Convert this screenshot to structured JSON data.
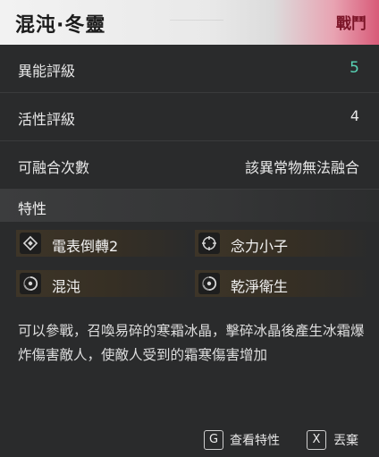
{
  "header": {
    "title": "混沌·冬靈",
    "tag": "戰鬥"
  },
  "stats": [
    {
      "label": "異能評級",
      "value": "5"
    },
    {
      "label": "活性評級",
      "value": "4"
    },
    {
      "label": "可融合次數",
      "value": "該異常物無法融合"
    }
  ],
  "traits_section": {
    "title": "特性",
    "items": [
      {
        "label": "電表倒轉2",
        "icon": "diamond-icon"
      },
      {
        "label": "念力小子",
        "icon": "crosshair-icon"
      },
      {
        "label": "混沌",
        "icon": "swirl-icon"
      },
      {
        "label": "乾淨衛生",
        "icon": "swirl-icon"
      }
    ]
  },
  "description": "可以參戰，召喚易碎的寒霜冰晶，擊碎冰晶後產生冰霜爆炸傷害敵人，使敵人受到的霜寒傷害增加",
  "footer": {
    "view_key": "G",
    "view_label": "查看特性",
    "drop_key": "X",
    "drop_label": "丟棄"
  },
  "colors": {
    "accent": "#58d3b5",
    "tag": "#7a1326"
  }
}
